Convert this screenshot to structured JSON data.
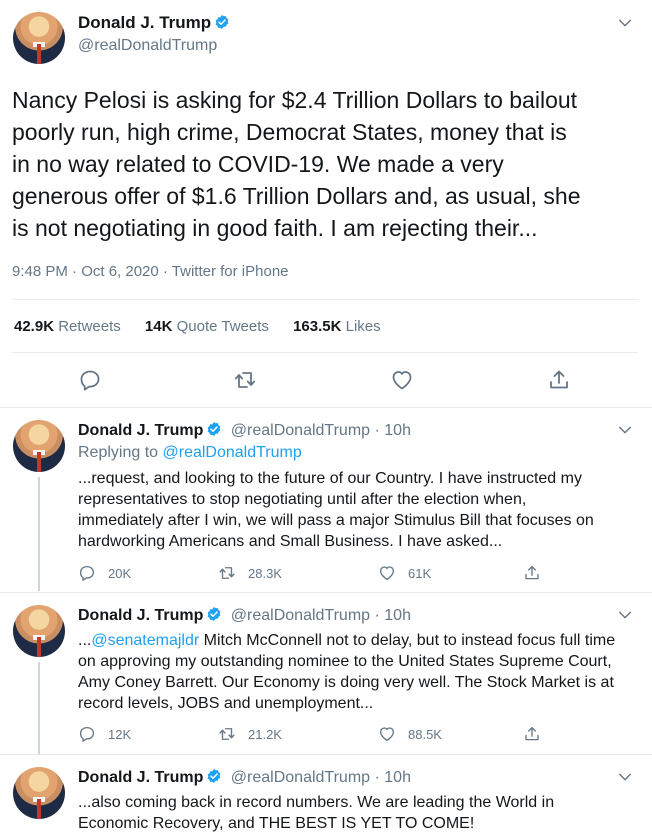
{
  "main": {
    "author_name": "Donald J. Trump",
    "author_handle": "@realDonaldTrump",
    "text_lines": [
      "Nancy Pelosi is asking for $2.4 Trillion Dollars to bailout",
      "poorly run, high crime, Democrat States, money that is",
      "in no way related to COVID-19. We made a very",
      "generous offer of $1.6 Trillion Dollars and, as usual, she",
      "is not negotiating in good faith. I am rejecting their..."
    ],
    "meta": "9:48 PM · Oct 6, 2020 · Twitter for iPhone",
    "stats": {
      "retweets_count": "42.9K",
      "retweets_label": "Retweets",
      "quotes_count": "14K",
      "quotes_label": "Quote Tweets",
      "likes_count": "163.5K",
      "likes_label": "Likes"
    }
  },
  "replies": [
    {
      "name": "Donald J. Trump",
      "handle": "@realDonaldTrump · 10h",
      "replying_label": "Replying to ",
      "replying_to": "@realDonaldTrump",
      "text_lines": [
        "...request, and looking to the future of our Country. I have instructed my",
        "representatives to stop negotiating until after the election when,",
        "immediately after I win, we will pass a major Stimulus Bill that focuses on",
        "hardworking Americans and Small Business. I have asked..."
      ],
      "replies_count": "20K",
      "retweets_count": "28.3K",
      "likes_count": "61K"
    },
    {
      "name": "Donald J. Trump",
      "handle": "@realDonaldTrump · 10h",
      "mention_prefix": "...",
      "mention": "@senatemajldr",
      "first_line_rest": " Mitch McConnell not to delay, but to instead focus full time",
      "text_lines": [
        "on approving my outstanding nominee to the United States Supreme Court,",
        "Amy Coney Barrett. Our Economy is doing very well. The Stock Market is at",
        "record levels, JOBS and unemployment..."
      ],
      "replies_count": "12K",
      "retweets_count": "21.2K",
      "likes_count": "88.5K"
    },
    {
      "name": "Donald J. Trump",
      "handle": "@realDonaldTrump · 10h",
      "text_lines": [
        "...also coming back in record numbers. We are leading the World in",
        "Economic Recovery, and THE BEST IS YET TO COME!"
      ]
    }
  ],
  "colors": {
    "accent": "#1da1f2",
    "muted": "#657786",
    "text": "#14171a",
    "border": "#e6ecf0"
  },
  "icons": [
    "verified-badge-icon",
    "chevron-down-icon",
    "reply-icon",
    "retweet-icon",
    "like-icon",
    "share-icon"
  ]
}
